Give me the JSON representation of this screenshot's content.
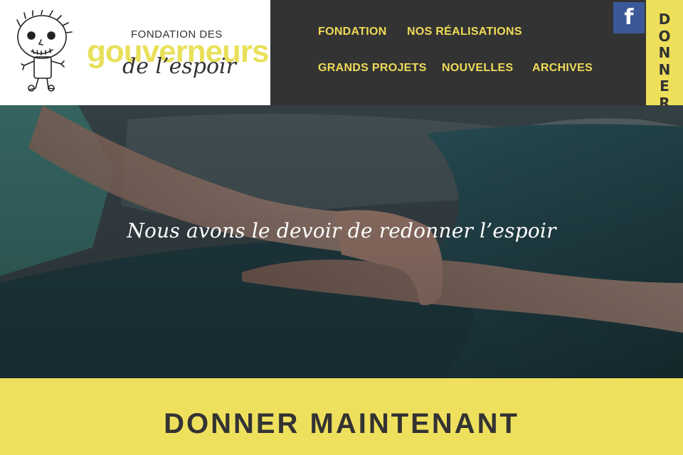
{
  "logo": {
    "line1": "FONDATION DES",
    "line2": "gouverneurs",
    "line3": "de l’espoir"
  },
  "nav": {
    "items": [
      {
        "label": "FONDATION"
      },
      {
        "label": "NOS RÉALISATIONS"
      },
      {
        "label": "GRANDS PROJETS"
      },
      {
        "label": "NOUVELLES"
      },
      {
        "label": "ARCHIVES"
      }
    ]
  },
  "social": {
    "facebook_icon": "facebook-icon",
    "facebook_glyph": "f"
  },
  "donate_tab": {
    "label": "DONNER",
    "letters": [
      "D",
      "O",
      "N",
      "N",
      "E",
      "R"
    ]
  },
  "hero": {
    "tagline": "Nous avons le devoir de redonner l’espoir"
  },
  "cta": {
    "title": "DONNER MAINTENANT"
  },
  "colors": {
    "accent_yellow": "#eddf5a",
    "header_dark": "#333333",
    "facebook_blue": "#3b5998",
    "logo_yellow": "#e8e05a"
  }
}
